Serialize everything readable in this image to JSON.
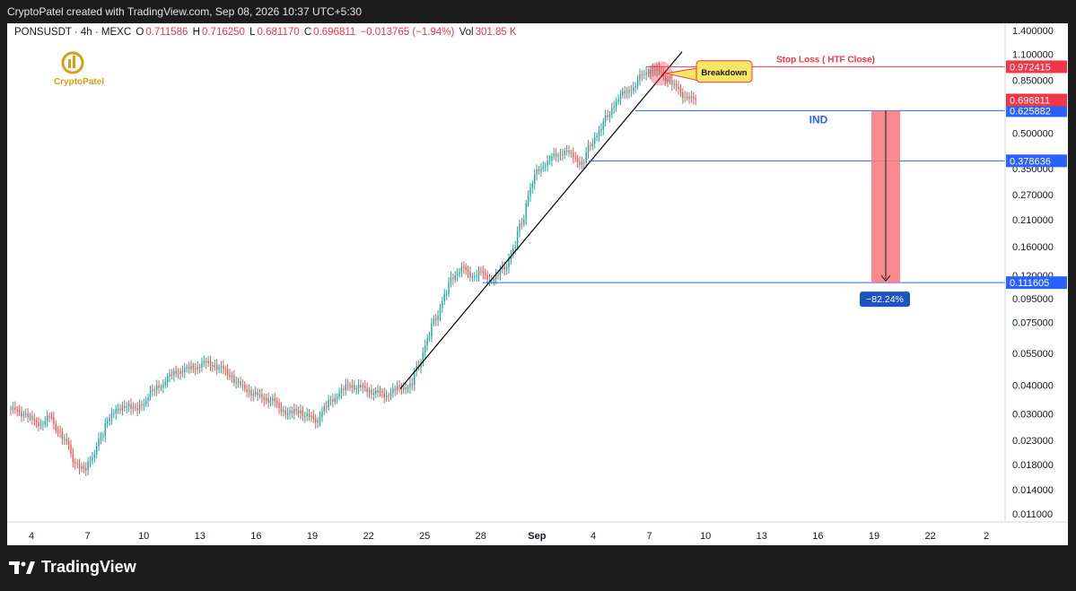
{
  "header": {
    "attribution": "CryptoPatel created with TradingView.com, Sep 08, 2026 10:37 UTC+5:30"
  },
  "symbol": {
    "name": "PONSUSDT · 4h · MEXC",
    "o_label": "O",
    "o_value": "0.711586",
    "h_label": "H",
    "h_value": "0.716250",
    "l_label": "L",
    "l_value": "0.681170",
    "c_label": "C",
    "c_value": "0.696811",
    "change": "−0.013765 (−1.94%)",
    "vol_label": "Vol",
    "vol_value": "301.85 K"
  },
  "logo": {
    "text": "CryptoPatel",
    "icon": "crypto-patel-logo"
  },
  "footer": {
    "brand": "TradingView",
    "icon": "tradingview-logo"
  },
  "colors": {
    "up": "#26a69a",
    "down": "#ef5350",
    "trendline": "#000000",
    "blue_line": "#2962ff",
    "stop_line": "#f23645",
    "target_box": "#f77c80"
  },
  "chart_data": {
    "type": "candlestick",
    "scale": "log",
    "ylim": [
      0.0105,
      1.45
    ],
    "y_ticks": [
      "1.400000",
      "1.100000",
      "0.850000",
      "0.500000",
      "0.350000",
      "0.270000",
      "0.210000",
      "0.160000",
      "0.120000",
      "0.095000",
      "0.075000",
      "0.055000",
      "0.040000",
      "0.030000",
      "0.023000",
      "0.018000",
      "0.014000",
      "0.011000"
    ],
    "y_tick_values": [
      1.4,
      1.1,
      0.85,
      0.5,
      0.35,
      0.27,
      0.21,
      0.16,
      0.12,
      0.095,
      0.075,
      0.055,
      0.04,
      0.03,
      0.023,
      0.018,
      0.014,
      0.011
    ],
    "x_ticks": [
      "4",
      "7",
      "10",
      "13",
      "16",
      "19",
      "22",
      "25",
      "28",
      "Sep",
      "4",
      "7",
      "10",
      "13",
      "16",
      "19",
      "22",
      "2"
    ],
    "series_close": [
      0.031,
      0.03,
      0.028,
      0.027,
      0.029,
      0.025,
      0.022,
      0.018,
      0.017,
      0.02,
      0.024,
      0.03,
      0.031,
      0.033,
      0.031,
      0.034,
      0.038,
      0.04,
      0.044,
      0.046,
      0.047,
      0.048,
      0.05,
      0.049,
      0.047,
      0.044,
      0.04,
      0.038,
      0.036,
      0.035,
      0.034,
      0.031,
      0.03,
      0.031,
      0.029,
      0.028,
      0.032,
      0.035,
      0.038,
      0.04,
      0.039,
      0.038,
      0.037,
      0.036,
      0.038,
      0.039,
      0.04,
      0.05,
      0.065,
      0.08,
      0.1,
      0.12,
      0.13,
      0.118,
      0.125,
      0.115,
      0.12,
      0.13,
      0.16,
      0.21,
      0.3,
      0.35,
      0.38,
      0.4,
      0.42,
      0.39,
      0.37,
      0.45,
      0.52,
      0.6,
      0.7,
      0.75,
      0.8,
      0.9,
      0.95,
      0.92,
      0.85,
      0.78,
      0.72,
      0.697
    ],
    "levels": [
      {
        "label": "Stop Loss ( HTF Close)",
        "value": 0.972415,
        "price_label": "0.972415",
        "color": "#f23645"
      },
      {
        "label": "IND",
        "value": 0.625882,
        "price_label": "0.625882",
        "color": "#2962ff"
      },
      {
        "label": "",
        "value": 0.378636,
        "price_label": "0.378636",
        "color": "#2962ff"
      },
      {
        "label": "",
        "value": 0.111605,
        "price_label": "0.111605",
        "color": "#2962ff"
      }
    ],
    "last_price": {
      "value": 0.696811,
      "price_label": "0.696811"
    },
    "annotations": {
      "breakdown_label": "Breakdown",
      "move_label": "−82.24%"
    }
  }
}
